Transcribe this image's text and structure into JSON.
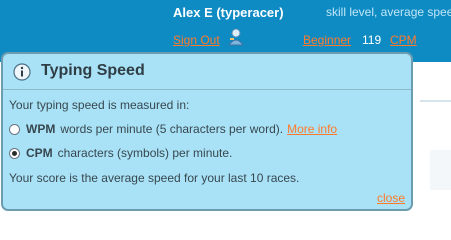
{
  "header": {
    "username": "Alex E (typeracer)",
    "skill_text": "skill level, average speed",
    "signout_label": "Sign Out",
    "level_label": "Beginner",
    "speed_value": "119",
    "speed_unit": "CPM",
    "person_icon": "user-icon"
  },
  "popup": {
    "title": "Typing Speed",
    "info_icon": "info-icon",
    "intro": "Your typing speed is measured in:",
    "options": [
      {
        "code": "WPM",
        "description": "words per minute (5 characters per word).",
        "link": "More info",
        "checked": false
      },
      {
        "code": "CPM",
        "description": "characters (symbols) per minute.",
        "checked": true
      }
    ],
    "score_text": "Your score is the average speed for your last 10 races.",
    "close_label": "close"
  },
  "colors": {
    "header_bg": "#0f8bc4",
    "popup_bg": "#a9e2f6",
    "link": "#ff7a2a"
  }
}
